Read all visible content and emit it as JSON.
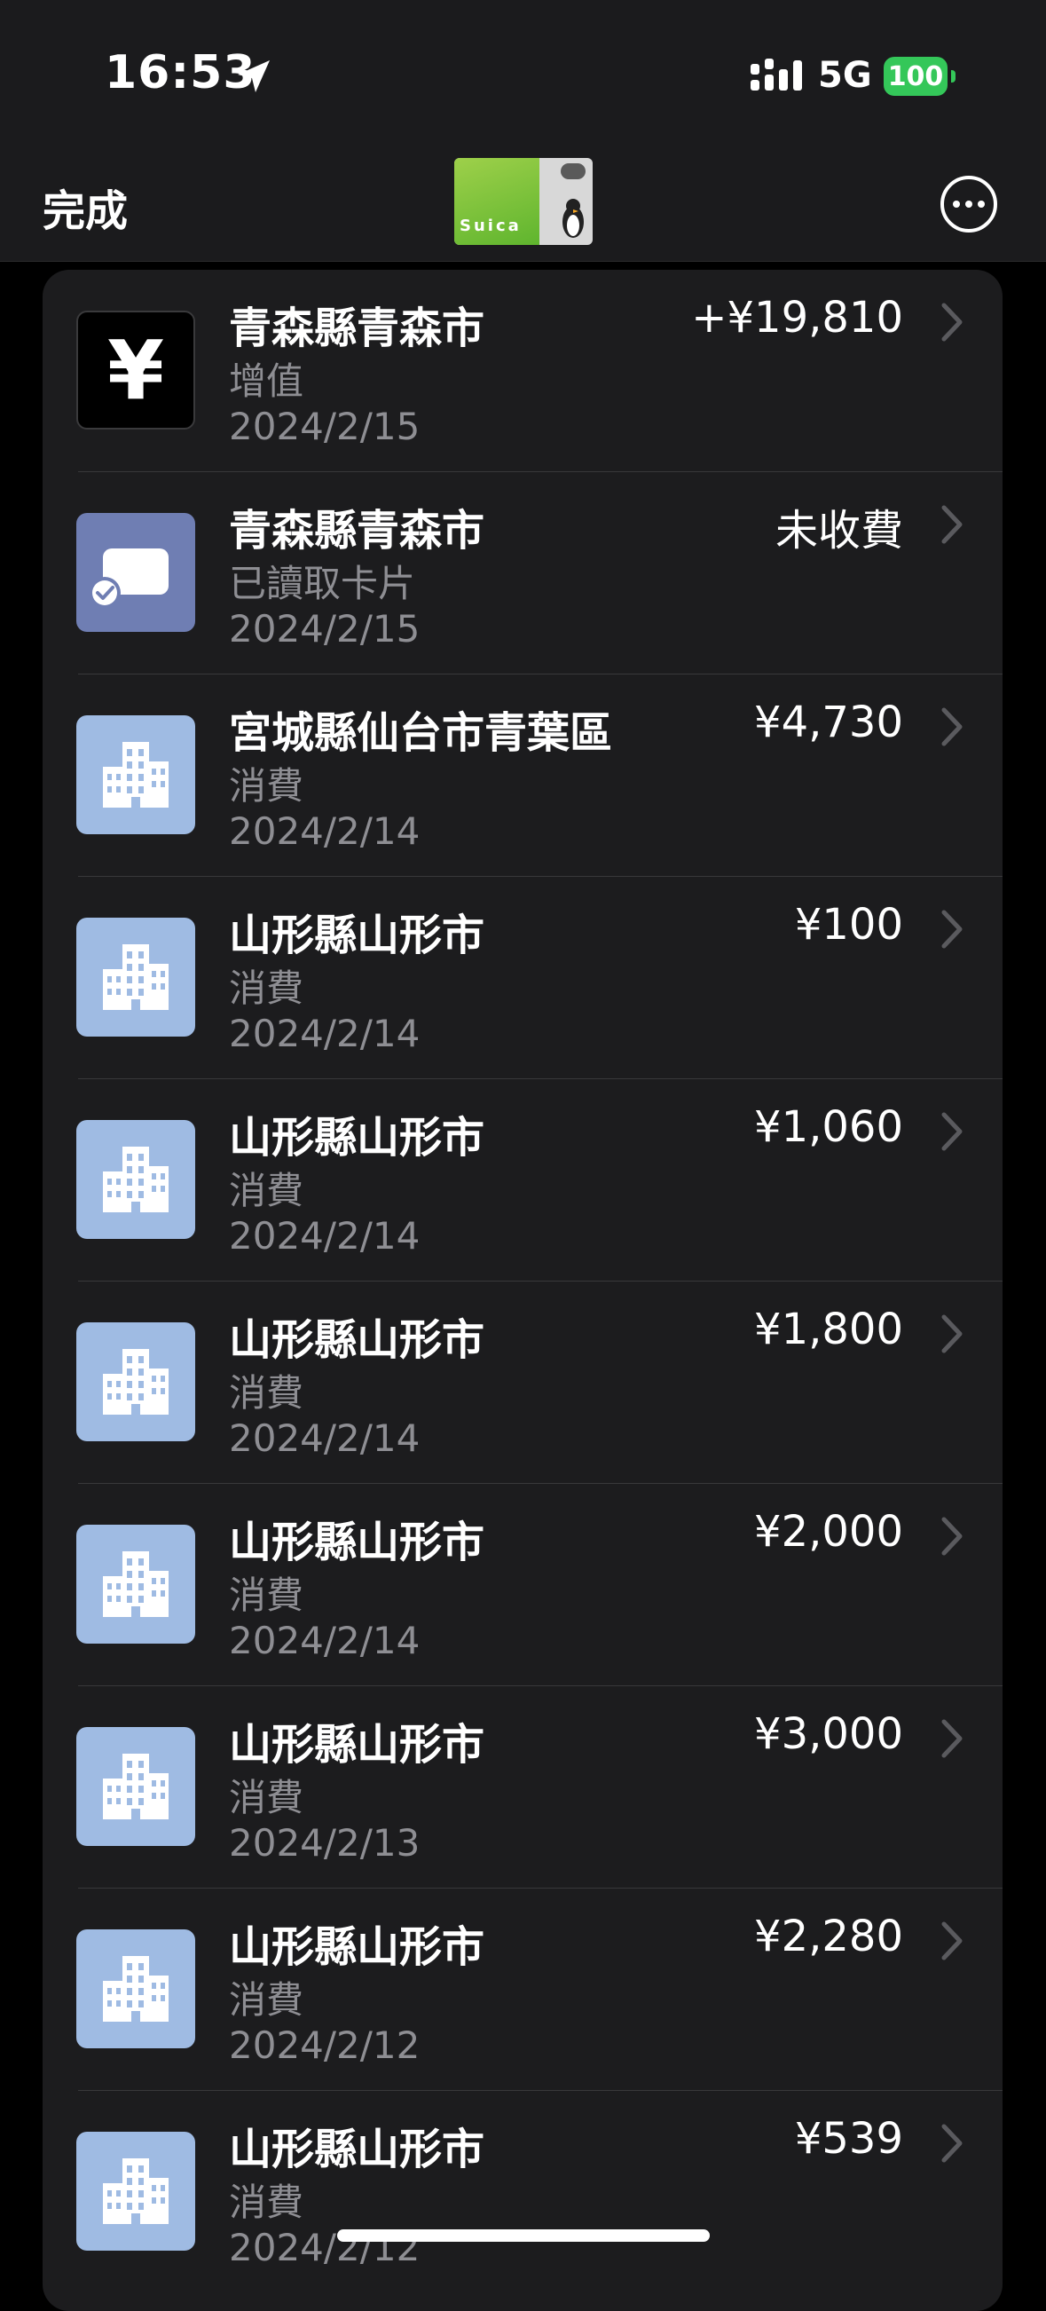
{
  "status": {
    "time": "16:53",
    "network": "5G",
    "battery": "100",
    "colors": {
      "battery": "#34c759"
    }
  },
  "nav": {
    "done_label": "完成",
    "card_name": "Suica"
  },
  "transactions": [
    {
      "icon": "yen-icon",
      "title": "青森縣青森市",
      "type": "增值",
      "date": "2024/2/15",
      "amount": "+¥19,810"
    },
    {
      "icon": "card-read-icon",
      "title": "青森縣青森市",
      "type": "已讀取卡片",
      "date": "2024/2/15",
      "amount": "未收費"
    },
    {
      "icon": "building-icon",
      "title": "宮城縣仙台市青葉區",
      "type": "消費",
      "date": "2024/2/14",
      "amount": "¥4,730"
    },
    {
      "icon": "building-icon",
      "title": "山形縣山形市",
      "type": "消費",
      "date": "2024/2/14",
      "amount": "¥100"
    },
    {
      "icon": "building-icon",
      "title": "山形縣山形市",
      "type": "消費",
      "date": "2024/2/14",
      "amount": "¥1,060"
    },
    {
      "icon": "building-icon",
      "title": "山形縣山形市",
      "type": "消費",
      "date": "2024/2/14",
      "amount": "¥1,800"
    },
    {
      "icon": "building-icon",
      "title": "山形縣山形市",
      "type": "消費",
      "date": "2024/2/14",
      "amount": "¥2,000"
    },
    {
      "icon": "building-icon",
      "title": "山形縣山形市",
      "type": "消費",
      "date": "2024/2/13",
      "amount": "¥3,000"
    },
    {
      "icon": "building-icon",
      "title": "山形縣山形市",
      "type": "消費",
      "date": "2024/2/12",
      "amount": "¥2,280"
    },
    {
      "icon": "building-icon",
      "title": "山形縣山形市",
      "type": "消費",
      "date": "2024/2/12",
      "amount": "¥539"
    }
  ]
}
